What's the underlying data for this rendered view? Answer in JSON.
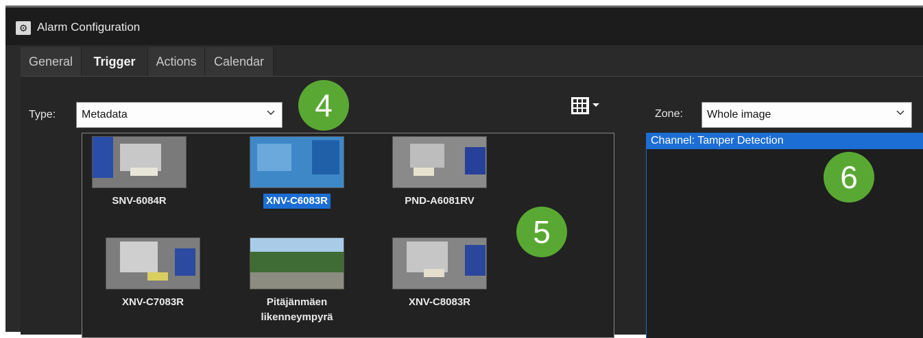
{
  "window": {
    "title": "Alarm Configuration",
    "icon": "gear-icon"
  },
  "tabs": [
    {
      "label": "General",
      "active": false
    },
    {
      "label": "Trigger",
      "active": true
    },
    {
      "label": "Actions",
      "active": false
    },
    {
      "label": "Calendar",
      "active": false
    }
  ],
  "trigger": {
    "type_label": "Type:",
    "type_value": "Metadata",
    "zone_label": "Zone:",
    "zone_value": "Whole image",
    "layout_icon": "grid-layout-icon"
  },
  "cameras": [
    {
      "label": "SNV-6084R",
      "selected": false
    },
    {
      "label": "XNV-C6083R",
      "selected": true
    },
    {
      "label": "PND-A6081RV",
      "selected": false
    },
    {
      "label": "XNV-C7083R",
      "selected": false
    },
    {
      "label": "Pitäjänmäen likenneympyrä",
      "selected": false
    },
    {
      "label": "XNV-C8083R",
      "selected": false
    }
  ],
  "zone_items": [
    {
      "label": "Channel: Tamper Detection",
      "selected": true
    }
  ],
  "badges": {
    "b4": "4",
    "b5": "5",
    "b6": "6"
  },
  "colors": {
    "accent": "#1c6ed4",
    "badge": "#5aa834",
    "background": "#2a2a2a"
  }
}
